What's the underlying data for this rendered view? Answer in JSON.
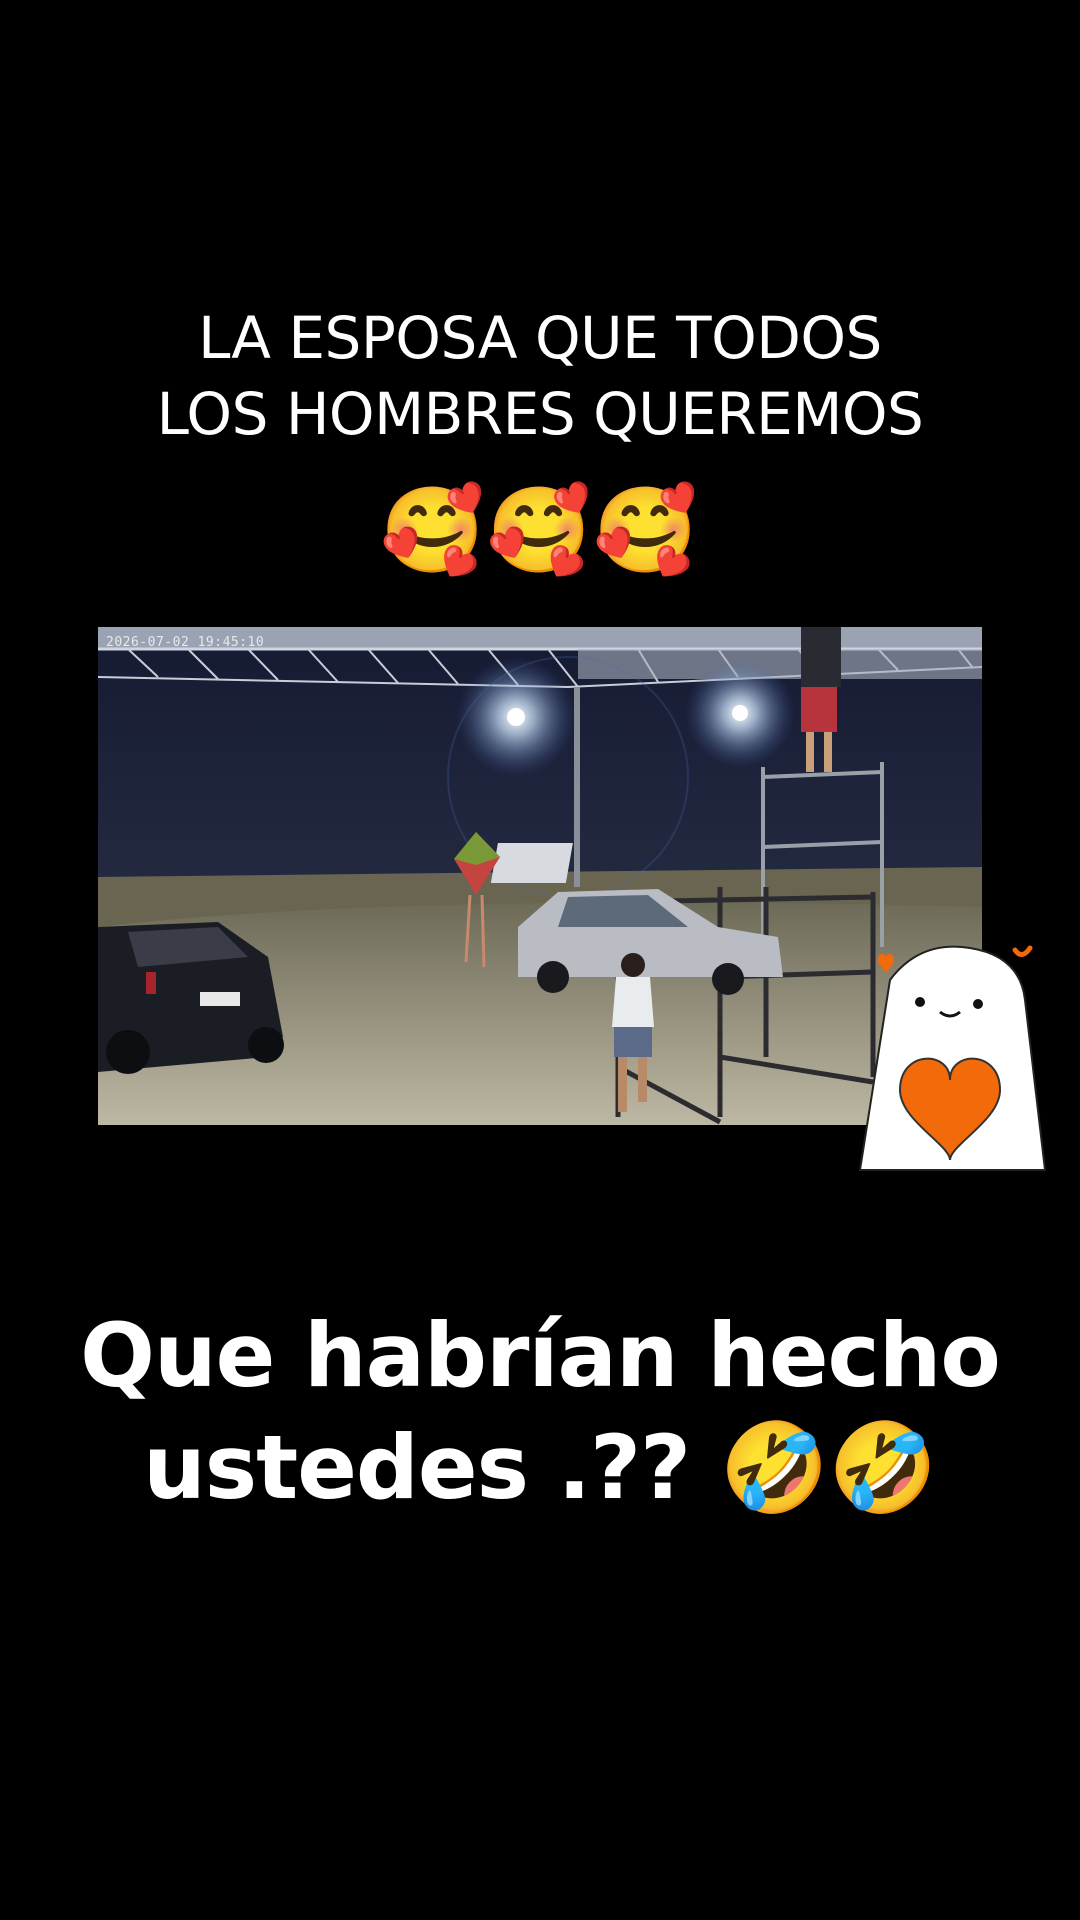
{
  "overlay": {
    "title_line1": "LA ESPOSA QUE TODOS",
    "title_line2": "LOS HOMBRES QUEREMOS",
    "emoji_line": "🥰🥰🥰",
    "question_line1": "Que habrían hecho",
    "question_line2": "ustedes .?? 🤣🤣"
  },
  "video": {
    "timestamp": "2026-07-02 19:45:10"
  },
  "sticker": {
    "icon": "heart-blob-sticker",
    "heart_color": "#f26a0a"
  }
}
